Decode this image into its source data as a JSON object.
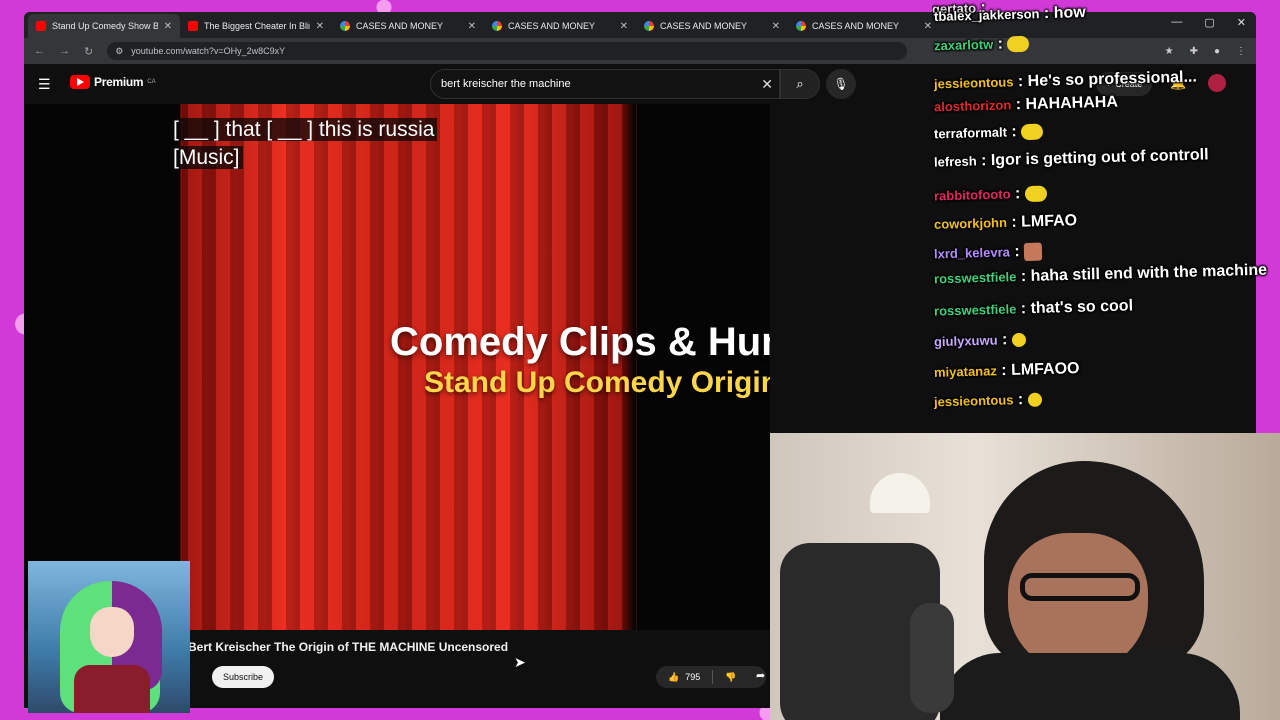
{
  "tabs": [
    {
      "title": "Stand Up Comedy Show Be",
      "icon": "youtube-icon",
      "active": true
    },
    {
      "title": "The Biggest Cheater In Blindfold",
      "icon": "youtube-icon",
      "active": false
    },
    {
      "title": "CASES AND MONEY",
      "icon": "google-icon",
      "active": false
    },
    {
      "title": "CASES AND MONEY",
      "icon": "google-icon",
      "active": false
    },
    {
      "title": "CASES AND MONEY",
      "icon": "google-icon",
      "active": false
    },
    {
      "title": "CASES AND MONEY",
      "icon": "google-icon",
      "active": false
    }
  ],
  "address": {
    "url": "youtube.com/watch?v=OHy_2w8C9xY"
  },
  "youtube": {
    "logo_text": "Premium",
    "region": "CA",
    "search_value": "bert kreischer the machine",
    "create_label": "Create"
  },
  "video": {
    "captions_line1": "[ __ ] that [ __ ] this is russia",
    "captions_line2": "[Music]",
    "title_overlay": "Comedy Clips & Humor",
    "subtitle_overlay": "Stand Up Comedy Originals",
    "name": "Bert Kreischer The Origin of THE MACHINE Uncensored",
    "subscribe_label": "Subscribe",
    "likes": "795"
  },
  "chat": [
    {
      "user": "gertato",
      "color": "#e0e0e0",
      "msg": "",
      "emote": ""
    },
    {
      "user": "tbalex_jakkerson",
      "color": "#ffffff",
      "msg": "how",
      "emote": ""
    },
    {
      "user": "zaxarlotw",
      "color": "#3fd07a",
      "msg": "",
      "emote": "pikachu-emote"
    },
    {
      "user": "jessieontous",
      "color": "#f0c020",
      "msg": "He's so professional...",
      "emote": ""
    },
    {
      "user": "alosthorizon",
      "color": "#e02828",
      "msg": "HAHAHAHA",
      "emote": ""
    },
    {
      "user": "terraformalt",
      "color": "#ffffff",
      "msg": "",
      "emote": "pikachu-emote"
    },
    {
      "user": "lefresh",
      "color": "#ffffff",
      "msg": "Igor is getting out of controll",
      "emote": ""
    },
    {
      "user": "rabbitofooto",
      "color": "#e02860",
      "msg": "",
      "emote": "pikachu-emote"
    },
    {
      "user": "coworkjohn",
      "color": "#f0c020",
      "msg": "LMFAO",
      "emote": ""
    },
    {
      "user": "lxrd_kelevra",
      "color": "#b48cff",
      "msg": "",
      "emote": "face-emote"
    },
    {
      "user": "rosswestfiele",
      "color": "#3fd07a",
      "msg": "haha still end with the machine",
      "emote": ""
    },
    {
      "user": "rosswestfiele",
      "color": "#3fd07a",
      "msg": "that's so cool",
      "emote": ""
    },
    {
      "user": "giulyxuwu",
      "color": "#c8a8ff",
      "msg": "",
      "emote": "laugh-emote"
    },
    {
      "user": "miyatanaz",
      "color": "#f0c020",
      "msg": "LMFAOO",
      "emote": ""
    },
    {
      "user": "jessieontous",
      "color": "#f0c020",
      "msg": "",
      "emote": "laugh-emote"
    }
  ],
  "colors": {
    "overlay": "#d23ad8",
    "yt_red": "#ff0000",
    "accent_gold": "#ffd64a"
  }
}
